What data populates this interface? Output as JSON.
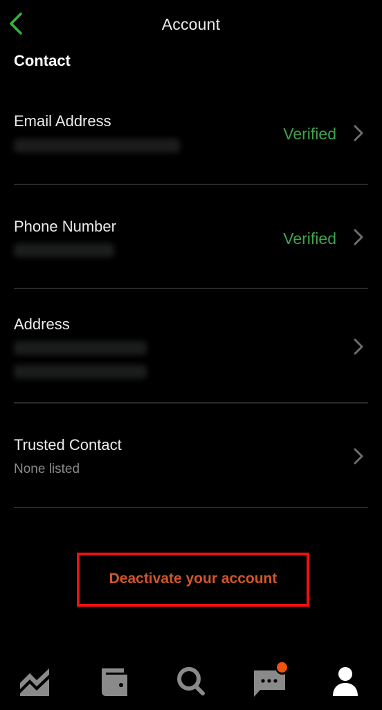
{
  "header": {
    "title": "Account",
    "back_icon": "chevron-left-icon"
  },
  "section": {
    "title": "Contact"
  },
  "rows": [
    {
      "label": "Email Address",
      "value": "[redacted]",
      "status": "Verified"
    },
    {
      "label": "Phone Number",
      "value": "[redacted]",
      "status": "Verified"
    },
    {
      "label": "Address",
      "value_line1": "[redacted]",
      "value_line2": "[redacted]",
      "status": ""
    },
    {
      "label": "Trusted Contact",
      "value": "None listed",
      "status": ""
    }
  ],
  "actions": {
    "deactivate_label": "Deactivate your account"
  },
  "tabbar": {
    "items": [
      {
        "name": "investing",
        "icon": "chart-icon",
        "active": false
      },
      {
        "name": "wallet",
        "icon": "wallet-icon",
        "active": false
      },
      {
        "name": "search",
        "icon": "search-icon",
        "active": false
      },
      {
        "name": "messages",
        "icon": "chat-icon",
        "active": false,
        "has_notification": true
      },
      {
        "name": "account",
        "icon": "person-icon",
        "active": true
      }
    ]
  },
  "colors": {
    "accent_green": "#3fa34d",
    "back_green": "#2fb83a",
    "danger_orange": "#d2562a",
    "highlight_red": "#f01010",
    "notification": "#f0520f",
    "icon_inactive": "#8a8a8a",
    "icon_active": "#ffffff"
  }
}
